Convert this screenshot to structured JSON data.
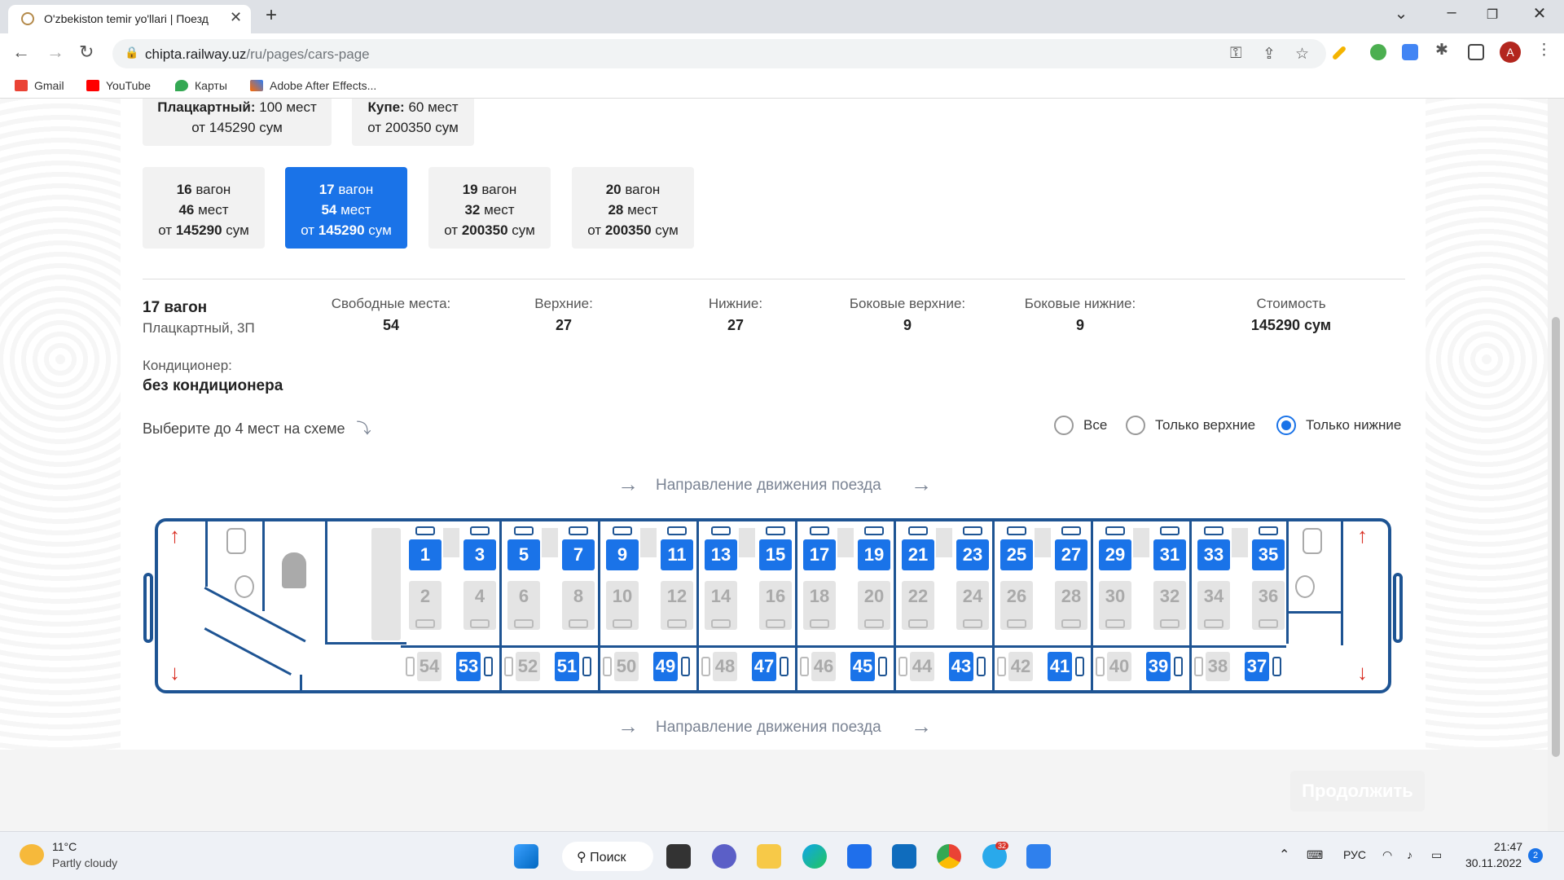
{
  "browser": {
    "tab_title": "O'zbekiston temir yo'llari | Поезд",
    "url_domain": "chipta.railway.uz",
    "url_path": "/ru/pages/cars-page",
    "profile": "A"
  },
  "bookmarks": [
    {
      "label": "Gmail",
      "color": "#ea4335"
    },
    {
      "label": "YouTube",
      "color": "#ff0000"
    },
    {
      "label": "Карты",
      "color": "#34a853"
    },
    {
      "label": "Adobe After Effects...",
      "color": "#9999ff"
    }
  ],
  "classes": [
    {
      "name": "Плацкартный:",
      "seats": "100 мест",
      "price": "от 145290 сум"
    },
    {
      "name": "Купе:",
      "seats": "60 мест",
      "price": "от 200350 сум"
    }
  ],
  "wagons": [
    {
      "n": "16",
      "label": "вагон",
      "seats": "46",
      "seats_label": "мест",
      "from": "от",
      "price": "145290",
      "cur": "сум",
      "selected": false
    },
    {
      "n": "17",
      "label": "вагон",
      "seats": "54",
      "seats_label": "мест",
      "from": "от",
      "price": "145290",
      "cur": "сум",
      "selected": true
    },
    {
      "n": "19",
      "label": "вагон",
      "seats": "32",
      "seats_label": "мест",
      "from": "от",
      "price": "200350",
      "cur": "сум",
      "selected": false
    },
    {
      "n": "20",
      "label": "вагон",
      "seats": "28",
      "seats_label": "мест",
      "from": "от",
      "price": "200350",
      "cur": "сум",
      "selected": false
    }
  ],
  "info": {
    "wagon": "17 вагон",
    "type": "Плацкартный, 3П",
    "free_label": "Свободные места:",
    "free": "54",
    "upper_label": "Верхние:",
    "upper": "27",
    "lower_label": "Нижние:",
    "lower": "27",
    "side_upper_label": "Боковые верхние:",
    "side_upper": "9",
    "side_lower_label": "Боковые нижние:",
    "side_lower": "9",
    "cost_label": "Стоимость",
    "cost": "145290 сум",
    "ac_label": "Кондиционер:",
    "ac": "без кондиционера"
  },
  "hint": "Выберите до 4 мест на схеме",
  "filters": [
    {
      "label": "Все",
      "checked": false
    },
    {
      "label": "Только верхние",
      "checked": false
    },
    {
      "label": "Только нижние",
      "checked": true
    }
  ],
  "direction": "Направление движения поезда",
  "compartments": [
    {
      "upper": [
        "1",
        "3"
      ],
      "lower": [
        "2",
        "4"
      ],
      "side": [
        "54",
        "53"
      ]
    },
    {
      "upper": [
        "5",
        "7"
      ],
      "lower": [
        "6",
        "8"
      ],
      "side": [
        "52",
        "51"
      ]
    },
    {
      "upper": [
        "9",
        "11"
      ],
      "lower": [
        "10",
        "12"
      ],
      "side": [
        "50",
        "49"
      ]
    },
    {
      "upper": [
        "13",
        "15"
      ],
      "lower": [
        "14",
        "16"
      ],
      "side": [
        "48",
        "47"
      ]
    },
    {
      "upper": [
        "17",
        "19"
      ],
      "lower": [
        "18",
        "20"
      ],
      "side": [
        "46",
        "45"
      ]
    },
    {
      "upper": [
        "21",
        "23"
      ],
      "lower": [
        "22",
        "24"
      ],
      "side": [
        "44",
        "43"
      ]
    },
    {
      "upper": [
        "25",
        "27"
      ],
      "lower": [
        "26",
        "28"
      ],
      "side": [
        "42",
        "41"
      ]
    },
    {
      "upper": [
        "29",
        "31"
      ],
      "lower": [
        "30",
        "32"
      ],
      "side": [
        "40",
        "39"
      ]
    },
    {
      "upper": [
        "33",
        "35"
      ],
      "lower": [
        "34",
        "36"
      ],
      "side": [
        "38",
        "37"
      ]
    }
  ],
  "colors": {
    "accent": "#1a73e8",
    "car": "#1e5493",
    "arrow": "#d93025"
  },
  "continue": "Продолжить",
  "taskbar": {
    "temp": "11°C",
    "weather": "Partly cloudy",
    "search": "Поиск",
    "lang": "РУС",
    "time": "21:47",
    "date": "30.11.2022",
    "notif": "2",
    "telegram_badge": "32"
  }
}
